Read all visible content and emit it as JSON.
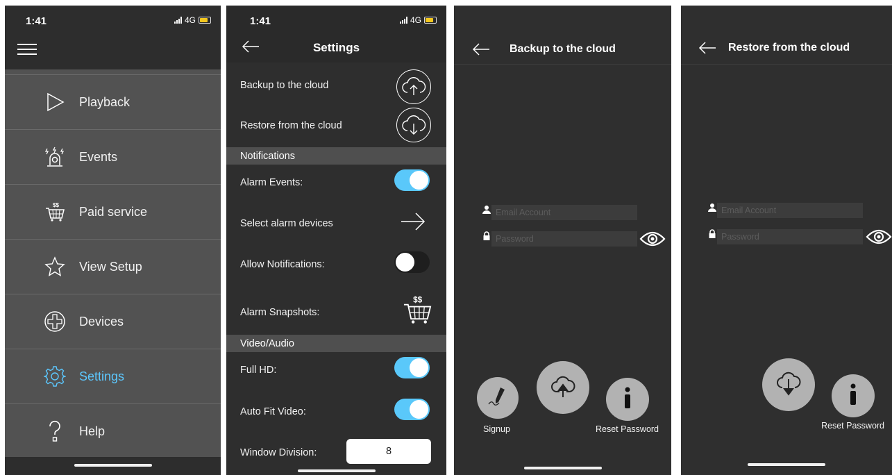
{
  "status": {
    "time": "1:41",
    "network": "4G"
  },
  "menu": {
    "items": [
      {
        "label": "Playback",
        "icon": "play-icon"
      },
      {
        "label": "Events",
        "icon": "alarm-siren-icon"
      },
      {
        "label": "Paid service",
        "icon": "shopping-cart-icon"
      },
      {
        "label": "View Setup",
        "icon": "star-icon"
      },
      {
        "label": "Devices",
        "icon": "add-circle-icon"
      },
      {
        "label": "Settings",
        "icon": "gear-icon",
        "active": true
      },
      {
        "label": "Help",
        "icon": "question-icon"
      }
    ],
    "active_color": "#5cc8ff"
  },
  "settings": {
    "title": "Settings",
    "backup_label": "Backup to the cloud",
    "restore_label": "Restore from the cloud",
    "notifications_header": "Notifications",
    "alarm_events_label": "Alarm Events:",
    "alarm_events_on": true,
    "select_alarm_devices_label": "Select alarm devices",
    "allow_notifications_label": "Allow Notifications:",
    "allow_notifications_on": false,
    "alarm_snapshots_label": "Alarm Snapshots:",
    "video_audio_header": "Video/Audio",
    "full_hd_label": "Full HD:",
    "full_hd_on": true,
    "auto_fit_label": "Auto Fit Video:",
    "auto_fit_on": true,
    "window_division_label": "Window Division:",
    "window_division_value": "8",
    "toggle_on_color": "#5ac8fa"
  },
  "backup": {
    "title": "Backup to the cloud",
    "email_placeholder": "Email Account",
    "password_placeholder": "Password",
    "signup_label": "Signup",
    "reset_password_label": "Reset Password"
  },
  "restore": {
    "title": "Restore from the cloud",
    "email_placeholder": "Email Account",
    "password_placeholder": "Password",
    "reset_password_label": "Reset Password"
  }
}
